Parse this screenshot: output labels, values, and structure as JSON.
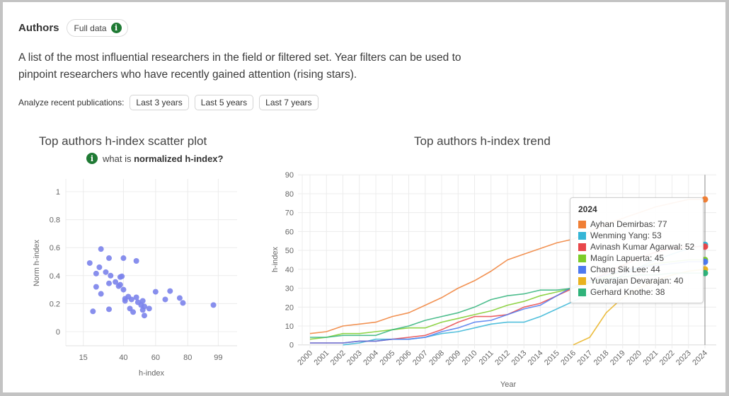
{
  "header": {
    "title": "Authors",
    "badge_label": "Full data",
    "badge_icon": "info-icon",
    "description": "A list of the most influential researchers in the field or filtered set. Year filters can be used to pinpoint researchers who have recently gained attention (rising stars).",
    "filters_label": "Analyze recent publications:",
    "filters": [
      "Last 3 years",
      "Last 5 years",
      "Last 7 years"
    ]
  },
  "scatter_help": {
    "prefix": "what is ",
    "bold": "normalized h-index?"
  },
  "colors": {
    "info_green": "#1f7a34",
    "scatter_point": "#7b83eb"
  },
  "chart_data": [
    {
      "type": "scatter",
      "title": "Top authors h-index scatter plot",
      "xlabel": "h-index",
      "ylabel": "Norm h-index",
      "xticks": [
        15,
        40,
        60,
        80,
        99
      ],
      "yticks": [
        0,
        0.2,
        0.4,
        0.6,
        0.8,
        1
      ],
      "ylim": [
        -0.1,
        1.1
      ],
      "grid": true,
      "color": "#7b83eb",
      "points": [
        [
          19,
          0.49
        ],
        [
          21,
          0.145
        ],
        [
          23,
          0.415
        ],
        [
          23,
          0.32
        ],
        [
          25,
          0.46
        ],
        [
          26,
          0.59
        ],
        [
          26,
          0.27
        ],
        [
          29,
          0.425
        ],
        [
          31,
          0.525
        ],
        [
          31,
          0.345
        ],
        [
          31,
          0.16
        ],
        [
          32,
          0.4
        ],
        [
          35,
          0.355
        ],
        [
          37,
          0.325
        ],
        [
          38,
          0.335
        ],
        [
          38,
          0.39
        ],
        [
          39,
          0.395
        ],
        [
          40,
          0.525
        ],
        [
          40,
          0.3
        ],
        [
          41,
          0.235
        ],
        [
          41,
          0.22
        ],
        [
          43,
          0.25
        ],
        [
          44,
          0.165
        ],
        [
          45,
          0.23
        ],
        [
          46,
          0.14
        ],
        [
          48,
          0.505
        ],
        [
          48,
          0.245
        ],
        [
          49,
          0.21
        ],
        [
          51,
          0.19
        ],
        [
          52,
          0.22
        ],
        [
          52,
          0.155
        ],
        [
          53,
          0.115
        ],
        [
          53,
          0.18
        ],
        [
          56,
          0.165
        ],
        [
          60,
          0.285
        ],
        [
          66,
          0.23
        ],
        [
          69,
          0.29
        ],
        [
          75,
          0.24
        ],
        [
          77,
          0.205
        ],
        [
          96,
          0.19
        ]
      ]
    },
    {
      "type": "line",
      "title": "Top authors h-index trend",
      "xlabel": "Year",
      "ylabel": "h-index",
      "ylim": [
        0,
        90
      ],
      "yticks": [
        0,
        10,
        20,
        30,
        40,
        50,
        60,
        70,
        80,
        90
      ],
      "x": [
        2000,
        2001,
        2002,
        2003,
        2004,
        2005,
        2006,
        2007,
        2008,
        2009,
        2010,
        2011,
        2012,
        2013,
        2014,
        2015,
        2016,
        2017,
        2018,
        2019,
        2020,
        2021,
        2022,
        2023,
        2024
      ],
      "grid": true,
      "highlight_x": 2024,
      "series": [
        {
          "name": "Ayhan Demirbas",
          "color": "#f07f35",
          "values": [
            6,
            7,
            10,
            11,
            12,
            15,
            17,
            21,
            25,
            30,
            34,
            39,
            45,
            48,
            51,
            54,
            56,
            60,
            64,
            67,
            70,
            73,
            75,
            77,
            77
          ]
        },
        {
          "name": "Wenming Yang",
          "color": "#35b5d6",
          "values": [
            null,
            null,
            0,
            1,
            3,
            3,
            3,
            4,
            6,
            7,
            9,
            11,
            12,
            12,
            15,
            19,
            23,
            27,
            32,
            37,
            41,
            45,
            48,
            51,
            53
          ]
        },
        {
          "name": "Avinash Kumar Agarwal",
          "color": "#e8474b",
          "values": [
            1,
            1,
            1,
            2,
            2,
            3,
            4,
            5,
            8,
            12,
            15,
            15,
            16,
            20,
            22,
            26,
            30,
            34,
            38,
            42,
            46,
            49,
            51,
            52,
            52
          ]
        },
        {
          "name": "Magín Lapuerta",
          "color": "#7ccc29",
          "values": [
            3,
            4,
            6,
            6,
            7,
            8,
            9,
            9,
            12,
            14,
            16,
            18,
            21,
            23,
            26,
            28,
            30,
            33,
            36,
            39,
            41,
            43,
            44,
            45,
            45
          ]
        },
        {
          "name": "Chang Sik Lee",
          "color": "#4d79f0",
          "values": [
            1,
            1,
            1,
            2,
            2,
            3,
            3,
            4,
            7,
            9,
            12,
            13,
            16,
            19,
            21,
            26,
            31,
            34,
            37,
            39,
            41,
            42,
            43,
            44,
            44
          ]
        },
        {
          "name": "Yuvarajan Devarajan",
          "color": "#e9b21f",
          "values": [
            null,
            null,
            null,
            null,
            null,
            null,
            null,
            null,
            null,
            null,
            null,
            null,
            null,
            null,
            null,
            null,
            0,
            4,
            17,
            25,
            30,
            34,
            37,
            39,
            40
          ]
        },
        {
          "name": "Gerhard Knothe",
          "color": "#2fb37a",
          "values": [
            4,
            4,
            5,
            5,
            5,
            8,
            10,
            13,
            15,
            17,
            20,
            24,
            26,
            27,
            29,
            29,
            30,
            33,
            35,
            36,
            37,
            37,
            38,
            38,
            38
          ]
        }
      ],
      "tooltip": {
        "title": "2024",
        "entries": [
          {
            "label": "Ayhan Demirbas: 77",
            "color": "#f07f35"
          },
          {
            "label": "Wenming Yang: 53",
            "color": "#35b5d6"
          },
          {
            "label": "Avinash Kumar Agarwal: 52",
            "color": "#e8474b"
          },
          {
            "label": "Magín Lapuerta: 45",
            "color": "#7ccc29"
          },
          {
            "label": "Chang Sik Lee: 44",
            "color": "#4d79f0"
          },
          {
            "label": "Yuvarajan Devarajan: 40",
            "color": "#e9b21f"
          },
          {
            "label": "Gerhard Knothe: 38",
            "color": "#2fb37a"
          }
        ]
      }
    }
  ]
}
